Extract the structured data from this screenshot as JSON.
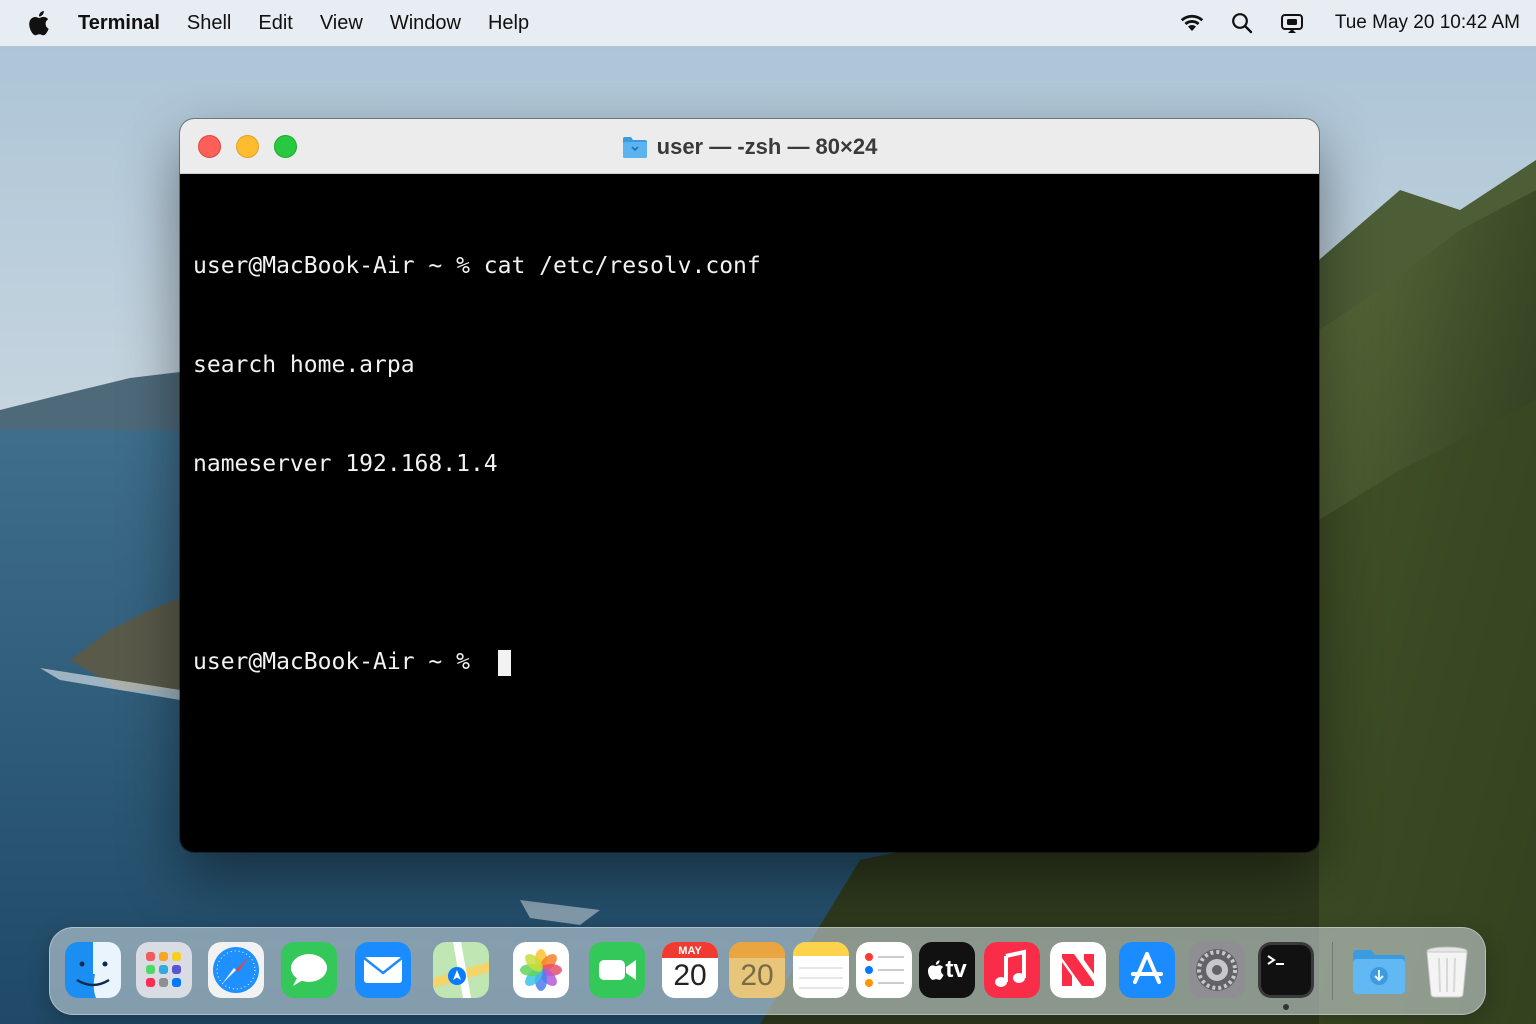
{
  "menubar": {
    "app_name": "Terminal",
    "items": [
      "Shell",
      "Edit",
      "View",
      "Window",
      "Help"
    ],
    "clock": "Tue May 20  10:42 AM",
    "status_icons": [
      "wifi-icon",
      "spotlight-search-icon",
      "control-center-icon"
    ]
  },
  "window": {
    "title": "user — -zsh — 80×24",
    "lines": [
      "user@MacBook-Air ~ % cat /etc/resolv.conf",
      "search home.arpa",
      "nameserver 192.168.1.4",
      "",
      "user@MacBook-Air ~ % "
    ]
  },
  "dock": {
    "apps": [
      "Finder",
      "Launchpad",
      "Safari",
      "Messages",
      "Mail",
      "Maps",
      "Photos",
      "FaceTime",
      "Calendar",
      "Contacts",
      "Notes",
      "Reminders",
      "TV",
      "Music",
      "News",
      "App Store",
      "System Settings",
      "Terminal",
      "Downloads",
      "Trash"
    ],
    "calendar_month": "MAY",
    "calendar_day": "20",
    "contacts_day": "20",
    "tv_label": "tv"
  },
  "colors": {
    "terminal_bg": "#000000",
    "terminal_fg": "#f2f2f2",
    "close": "#fe5f57",
    "minimize": "#febc2e",
    "maximize": "#28c840"
  }
}
